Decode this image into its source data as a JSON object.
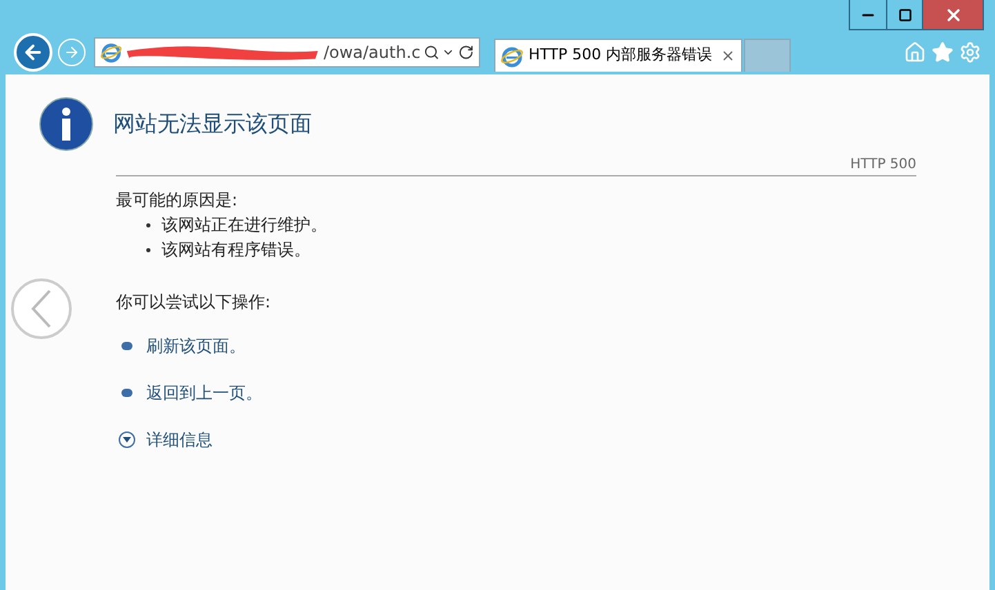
{
  "address_bar": {
    "value": "/owa/auth.c"
  },
  "tabs": [
    {
      "label": "HTTP 500 内部服务器错误",
      "selected": true
    }
  ],
  "page": {
    "title": "网站无法显示该页面",
    "code": "HTTP 500",
    "causes_heading": "最可能的原因是:",
    "causes": [
      "该网站正在进行维护。",
      "该网站有程序错误。"
    ],
    "actions_heading": "你可以尝试以下操作:",
    "actions": [
      {
        "label": "刷新该页面。",
        "kind": "link"
      },
      {
        "label": "返回到上一页。",
        "kind": "link"
      },
      {
        "label": "详细信息",
        "kind": "expander",
        "expanded": false
      }
    ]
  }
}
